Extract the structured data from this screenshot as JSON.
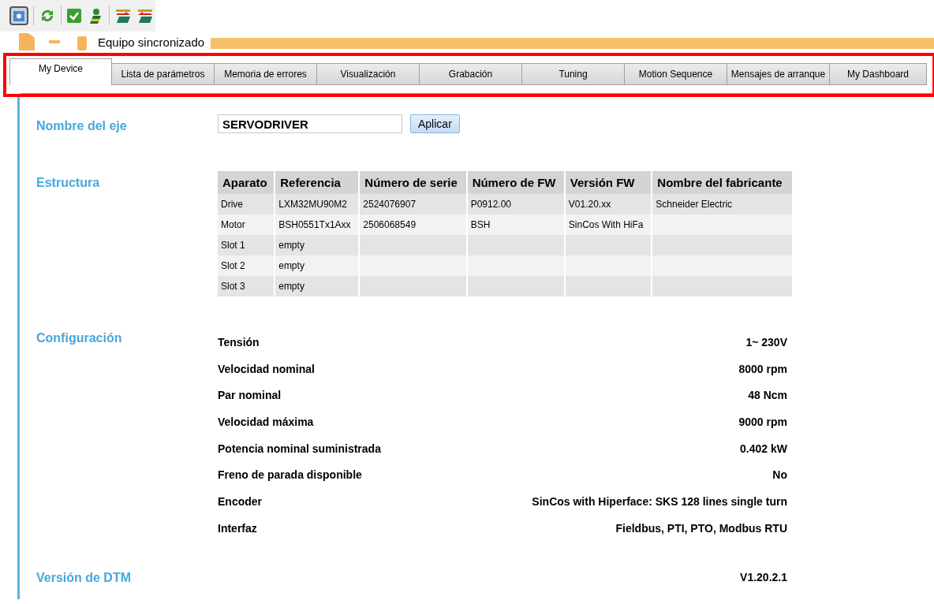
{
  "status": {
    "text": "Equipo sincronizado"
  },
  "tabs": [
    {
      "label": "My Device",
      "selected": true
    },
    {
      "label": "Lista de parámetros",
      "selected": false
    },
    {
      "label": "Memoria de errores",
      "selected": false
    },
    {
      "label": "Visualización",
      "selected": false
    },
    {
      "label": "Grabación",
      "selected": false
    },
    {
      "label": "Tuning",
      "selected": false
    },
    {
      "label": "Motion Sequence",
      "selected": false
    },
    {
      "label": "Mensajes de arranque",
      "selected": false
    },
    {
      "label": "My Dashboard",
      "selected": false
    }
  ],
  "axis_name": {
    "label": "Nombre del eje",
    "value": "SERVODRIVER",
    "button": "Aplicar"
  },
  "structure": {
    "label": "Estructura",
    "columns": [
      "Aparato",
      "Referencia",
      "Número de serie",
      "Número de FW",
      "Versión FW",
      "Nombre del fabricante"
    ],
    "rows": [
      [
        "Drive",
        "LXM32MU90M2",
        "2524076907",
        "P0912.00",
        "V01.20.xx",
        "Schneider Electric"
      ],
      [
        "Motor",
        "BSH0551Tx1Axx",
        "2506068549",
        "BSH",
        "SinCos With HiFa",
        ""
      ],
      [
        "Slot 1",
        "empty",
        "",
        "",
        "",
        ""
      ],
      [
        "Slot 2",
        "empty",
        "",
        "",
        "",
        ""
      ],
      [
        "Slot 3",
        "empty",
        "",
        "",
        "",
        ""
      ]
    ]
  },
  "configuration": {
    "label": "Configuración",
    "rows": [
      {
        "label": "Tensión",
        "value": "1~ 230V"
      },
      {
        "label": "Velocidad nominal",
        "value": "8000 rpm"
      },
      {
        "label": "Par nominal",
        "value": "48 Ncm"
      },
      {
        "label": "Velocidad máxima",
        "value": "9000 rpm"
      },
      {
        "label": "Potencia nominal suministrada",
        "value": "0.402 kW"
      },
      {
        "label": "Freno de parada disponible",
        "value": "No"
      },
      {
        "label": "Encoder",
        "value": "SinCos with Hiperface: SKS 128 lines single turn"
      },
      {
        "label": "Interfaz",
        "value": "Fieldbus, PTI, PTO, Modbus RTU"
      }
    ]
  },
  "dtm_version": {
    "label": "Versión de DTM",
    "value": "V1.20.2.1"
  }
}
